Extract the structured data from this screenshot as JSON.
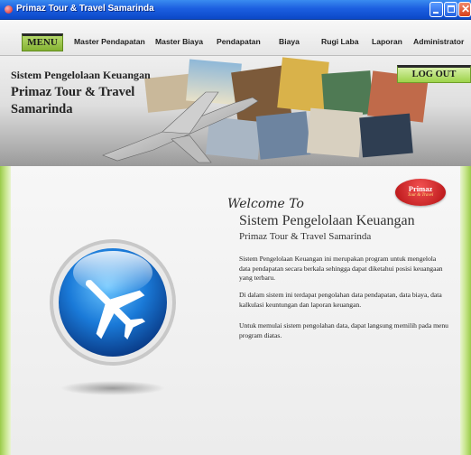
{
  "window": {
    "title": "Primaz Tour & Travel Samarinda",
    "buttons": {
      "minimize": "minimize",
      "maximize": "maximize",
      "close": "✕"
    }
  },
  "menu": {
    "menu_button": "MENU",
    "items": [
      {
        "label": "Master Pendapatan"
      },
      {
        "label": "Master Biaya"
      },
      {
        "label": "Pendapatan"
      },
      {
        "label": "Biaya"
      },
      {
        "label": "Rugi Laba"
      },
      {
        "label": "Laporan"
      },
      {
        "label": "Administrator"
      }
    ]
  },
  "banner": {
    "line1": "Sistem Pengelolaan Keuangan",
    "line2": "Primaz Tour & Travel",
    "line3": "Samarinda",
    "logout": "LOG OUT"
  },
  "welcome": {
    "script": "Welcome To",
    "title": "Sistem Pengelolaan Keuangan",
    "subtitle": "Primaz Tour & Travel Samarinda",
    "paragraphs": [
      "Sistem Pengelolaan Keuangan ini merupakan program untuk mengelola data pendapatan secara berkala sehingga dapat diketahui posisi keuangaan yang terbaru.",
      "Di dalam sistem ini terdapat pengolahan data pendapatan, data biaya, data kalkulasi keuntungan dan laporan keuangan.",
      "Untuk memulai sistem pengolahan data, dapat langsung memilih pada menu program diatas."
    ]
  },
  "badge": {
    "line1": "Primaz",
    "line2": "Tour & Travel"
  },
  "colors": {
    "titlebar": "#1c5fe0",
    "menu_green": "#84b232",
    "logout_green": "#9dd34a",
    "badge_red": "#c8171b",
    "side_green": "#9acb4a"
  },
  "icons": {
    "app": "app-icon",
    "hero": "airplane-icon",
    "banner": "airplane-collage"
  }
}
